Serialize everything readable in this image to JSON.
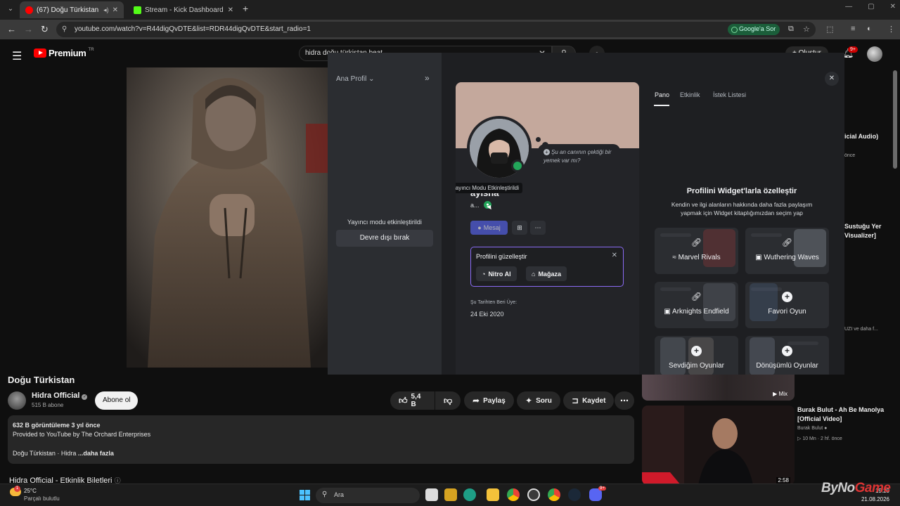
{
  "browser": {
    "tabs": [
      {
        "label": "(67) Doğu Türkistan - YouTube",
        "favicon_color": "#ff0000"
      },
      {
        "label": "Stream - Kick Dashboard",
        "favicon_color": "#53fc18"
      }
    ],
    "url": "youtube.com/watch?v=R44digQvDTE&list=RDR44digQvDTE&start_radio=1",
    "google_search_label": "Google'a Sor"
  },
  "youtube": {
    "logo_text": "Premium",
    "logo_region": "TR",
    "search_query": "hidra doğu türkistan beat",
    "create_label": "Oluştur",
    "notif_count": "9+",
    "video": {
      "title": "Doğu Türkistan",
      "channel": "Hidra Official",
      "subscribers": "515 B abone",
      "subscribe_label": "Abone ol",
      "likes": "5,4 B",
      "share_label": "Paylaş",
      "ask_label": "Soru",
      "save_label": "Kaydet",
      "views_line": "632 B görüntüleme  3 yıl önce",
      "provided_line": "Provided to YouTube by The Orchard Enterprises",
      "desc_prefix": "Doğu Türkistan · Hidra",
      "more_label": "...daha fazla",
      "tickets_label": "Hidra Official - Etkinlik Biletleri"
    },
    "recommendations": [
      {
        "fragment": "icial Audio)",
        "meta": "önce"
      },
      {
        "fragment": "Sustuğu Yer",
        "fragment2": "Visualizer]"
      },
      {
        "fragment": "UZI ve daha f..."
      },
      {
        "mix_label": "Mix"
      },
      {
        "title_line1": "Burak Bulut - Ah Be Manolya",
        "title_line2": "[Official Video]",
        "channel": "Burak Bulut",
        "views": "10 Mn",
        "age": "2 hf. önce",
        "duration": "2:58"
      }
    ]
  },
  "discord": {
    "sidebar": {
      "profile_select": "Ana Profil",
      "streamer_mode_label": "Yayıncı modu etkinleştirildi",
      "disable_button": "Devre dışı bırak"
    },
    "profile": {
      "status_bubble": "Şu an canının çektiği bir yemek var mı?",
      "tooltip": "Yayıncı Modu Etkinleştirildi",
      "username": "ayisha",
      "tag": "a...",
      "message_button": "Mesaj",
      "customize_title": "Profilini güzelleştir",
      "nitro_label": "Nitro Al",
      "shop_label": "Mağaza",
      "member_since_label": "Şu Tarihten Beri Üye:",
      "member_since_date": "24 Eki 2020",
      "banner_color": "#c4a89c",
      "status_color": "#23a55a"
    },
    "tabs": [
      "Pano",
      "Etkinlik",
      "İstek Listesi"
    ],
    "widgets": {
      "title": "Profilini Widget'larla özelleştir",
      "description": "Kendin ve ilgi alanların hakkında daha fazla paylaşım yapmak için Widget kitaplığımızdan seçim yap",
      "cards": [
        {
          "label": "Marvel Rivals",
          "icon": "link-icon"
        },
        {
          "label": "Wuthering Waves",
          "icon": "link-icon"
        },
        {
          "label": "Arknights Endfield",
          "icon": "link-icon"
        },
        {
          "label": "Favori Oyun",
          "icon": "plus-icon"
        },
        {
          "label": "Sevdiğim Oyunlar",
          "icon": "plus-icon"
        },
        {
          "label": "Dönüşümlü Oyunlar",
          "icon": "plus-icon"
        }
      ]
    }
  },
  "taskbar": {
    "weather_temp": "25°C",
    "weather_desc": "Parçalı bulutlu",
    "weather_badge": "1",
    "search_placeholder": "Ara",
    "discord_badge": "9+",
    "time": "19:20",
    "date": "21.08.2026"
  },
  "watermark": {
    "part1": "ByNo",
    "part2": "Game"
  }
}
